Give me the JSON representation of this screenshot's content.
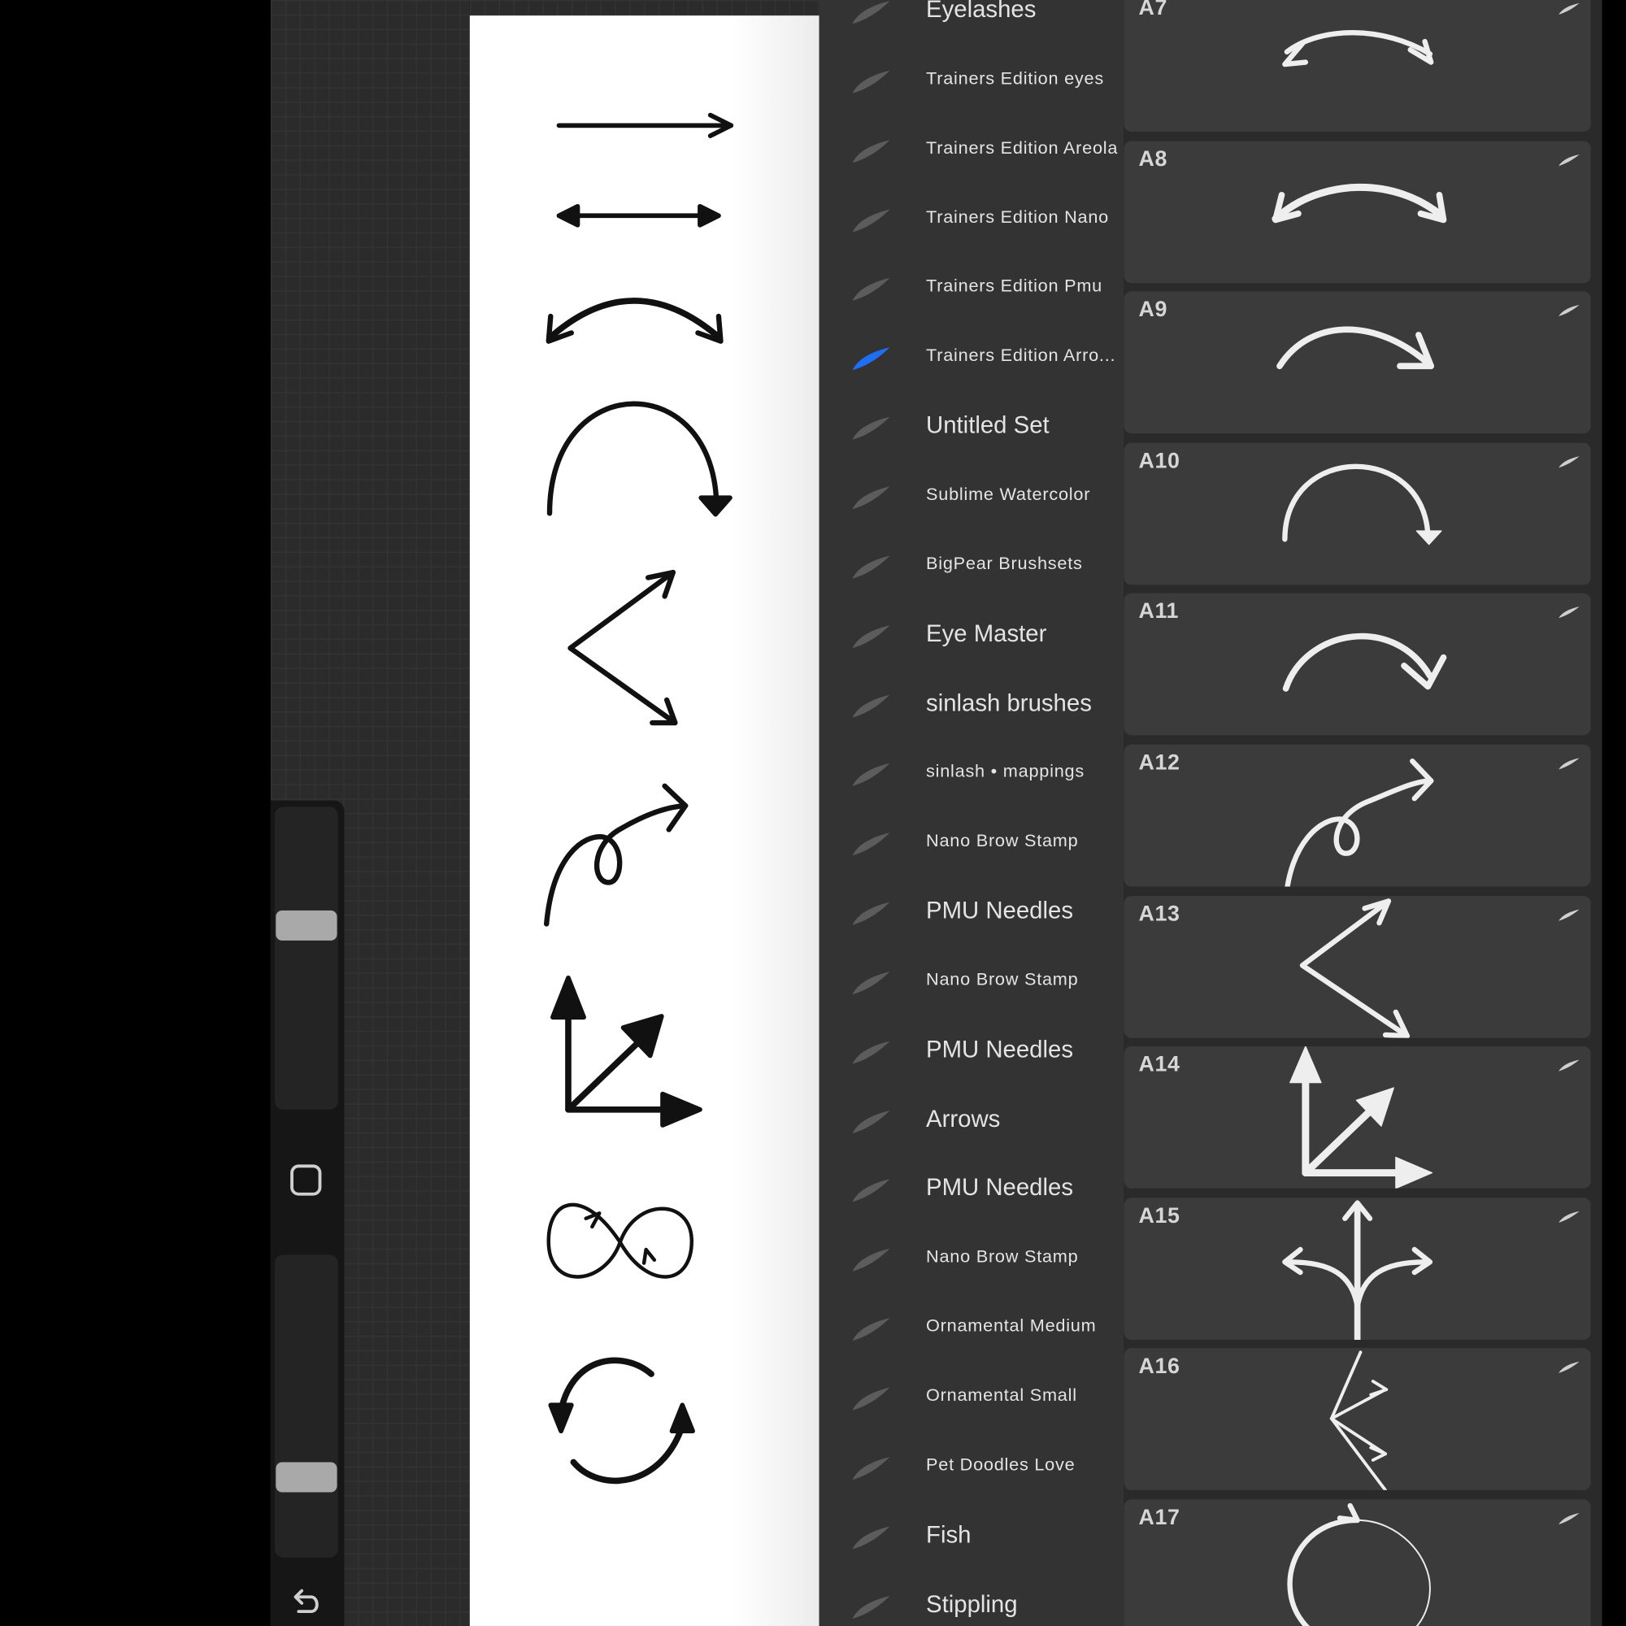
{
  "brush_library": {
    "sets": [
      {
        "label": "Eyelashes",
        "size": "lg",
        "active": false
      },
      {
        "label": "Trainers Edition eyes",
        "size": "sm",
        "active": false
      },
      {
        "label": "Trainers Edition Areola",
        "size": "sm",
        "active": false
      },
      {
        "label": "Trainers Edition Nano",
        "size": "sm",
        "active": false
      },
      {
        "label": "Trainers Edition Pmu",
        "size": "sm",
        "active": false
      },
      {
        "label": "Trainers Edition Arro...",
        "size": "sm",
        "active": true
      },
      {
        "label": "Untitled Set",
        "size": "lg",
        "active": false
      },
      {
        "label": "Sublime Watercolor",
        "size": "sm",
        "active": false
      },
      {
        "label": "BigPear Brushsets",
        "size": "sm",
        "active": false
      },
      {
        "label": "Eye Master",
        "size": "lg",
        "active": false
      },
      {
        "label": "sinlash brushes",
        "size": "lg",
        "active": false
      },
      {
        "label": "sinlash • mappings",
        "size": "sm",
        "active": false
      },
      {
        "label": "Nano Brow Stamp",
        "size": "sm",
        "active": false
      },
      {
        "label": "PMU Needles",
        "size": "lg",
        "active": false
      },
      {
        "label": "Nano Brow Stamp",
        "size": "sm",
        "active": false
      },
      {
        "label": "PMU Needles",
        "size": "lg",
        "active": false
      },
      {
        "label": "Arrows",
        "size": "lg",
        "active": false
      },
      {
        "label": "PMU Needles",
        "size": "lg",
        "active": false
      },
      {
        "label": "Nano Brow Stamp",
        "size": "sm",
        "active": false
      },
      {
        "label": "Ornamental Medium",
        "size": "sm",
        "active": false
      },
      {
        "label": "Ornamental Small",
        "size": "sm",
        "active": false
      },
      {
        "label": "Pet Doodles Love",
        "size": "sm",
        "active": false
      },
      {
        "label": "Fish",
        "size": "lg",
        "active": false
      },
      {
        "label": "Stippling",
        "size": "lg",
        "active": false
      }
    ],
    "brushes": [
      {
        "name": "A7"
      },
      {
        "name": "A8"
      },
      {
        "name": "A9"
      },
      {
        "name": "A10"
      },
      {
        "name": "A11"
      },
      {
        "name": "A12"
      },
      {
        "name": "A13"
      },
      {
        "name": "A14"
      },
      {
        "name": "A15"
      },
      {
        "name": "A16"
      },
      {
        "name": "A17"
      }
    ]
  },
  "sidebar": {
    "brush_size_level": 0.62,
    "opacity_level": 0.24,
    "modify_icon": "square-icon",
    "undo_icon": "undo-icon"
  },
  "canvas": {
    "drawn_arrows": [
      "straight-arrow-icon",
      "double-arrow-icon",
      "curved-double-arrow-icon",
      "semicircle-arrow-icon",
      "chevron-double-arrow-icon",
      "loop-arrow-icon",
      "axes-arrow-icon",
      "infinity-arrow-icon",
      "circular-arrows-icon"
    ]
  },
  "colors": {
    "active_accent": "#1e6ff5",
    "panel_bg": "#333333",
    "card_bg": "#3b3b3b"
  }
}
